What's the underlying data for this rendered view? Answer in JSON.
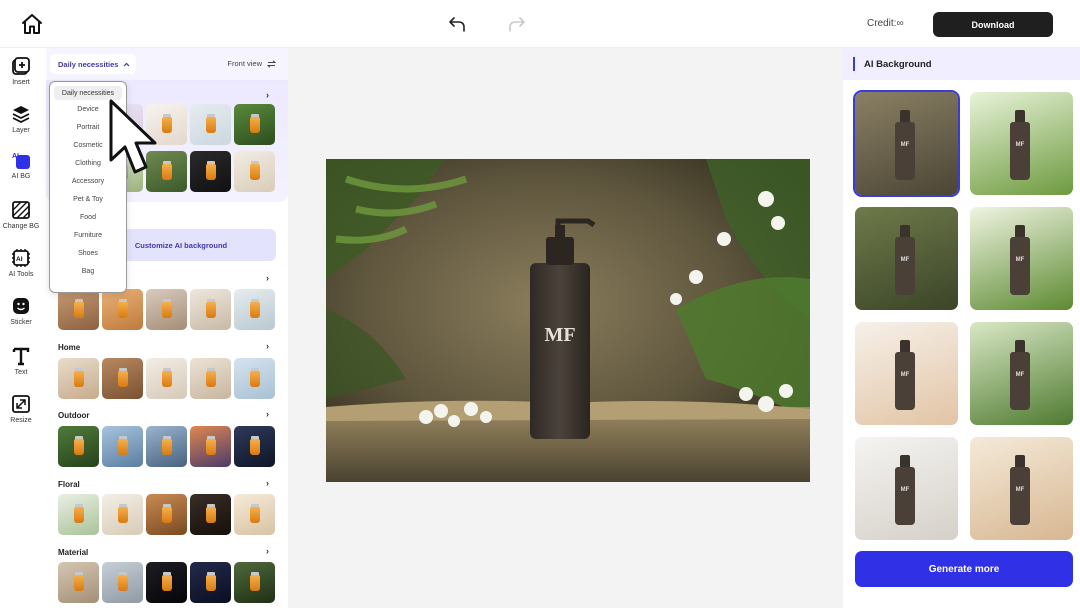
{
  "header": {
    "credit_label": "Credit:∞",
    "download_label": "Download"
  },
  "toolbar": {
    "items": [
      {
        "label": "Insert",
        "icon": "insert-icon"
      },
      {
        "label": "Layer",
        "icon": "layer-icon"
      },
      {
        "label": "AI BG",
        "icon": "ai-bg-icon"
      },
      {
        "label": "Change BG",
        "icon": "change-bg-icon"
      },
      {
        "label": "AI Tools",
        "icon": "ai-tools-icon"
      },
      {
        "label": "Sticker",
        "icon": "sticker-icon"
      },
      {
        "label": "Text",
        "icon": "text-icon"
      },
      {
        "label": "Resize",
        "icon": "resize-icon"
      }
    ]
  },
  "panel": {
    "category_selected": "Daily necessities",
    "view_selected": "Front view",
    "customize_label": "Customize AI background",
    "sections": [
      {
        "title": "Home"
      },
      {
        "title": "Outdoor"
      },
      {
        "title": "Floral"
      },
      {
        "title": "Material"
      }
    ]
  },
  "dropdown": {
    "options": [
      "Daily necessities",
      "Device",
      "Portrait",
      "Cosmetic",
      "Clothing",
      "Accessory",
      "Pet & Toy",
      "Food",
      "Furniture",
      "Shoes",
      "Bag"
    ]
  },
  "canvas": {
    "product_logo": "MF"
  },
  "right_panel": {
    "title": "AI Background",
    "generate_label": "Generate more"
  },
  "colors": {
    "accent": "#3030e6",
    "accent_text": "#3d3aa8",
    "panel_tint": "#f1efff",
    "download_bg": "#1f1f1f"
  }
}
